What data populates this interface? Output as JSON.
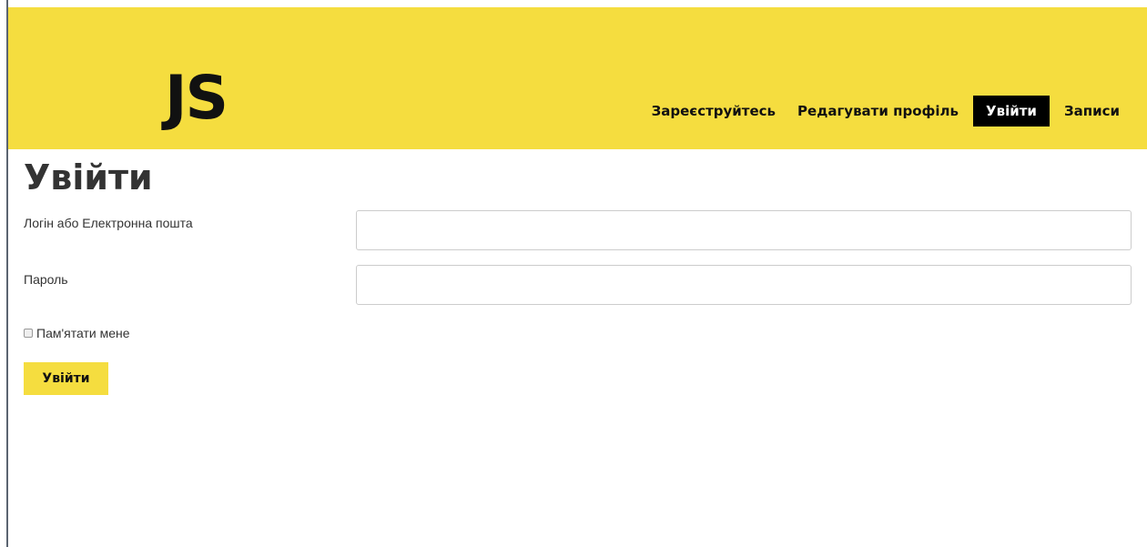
{
  "header": {
    "logo_text": "JS",
    "nav": [
      {
        "label": "Зареєструйтесь",
        "active": false
      },
      {
        "label": "Редагувати профіль",
        "active": false
      },
      {
        "label": "Увійти",
        "active": true
      },
      {
        "label": "Записи",
        "active": false
      }
    ]
  },
  "main": {
    "title": "Увійти",
    "login_label": "Логін або Електронна пошта",
    "login_value": "",
    "password_label": "Пароль",
    "password_value": "",
    "remember_label": "Пам'ятати мене",
    "remember_checked": false,
    "submit_label": "Увійти"
  },
  "colors": {
    "header_bg": "#f5dd3f",
    "active_nav_bg": "#000000",
    "button_bg": "#f5dd3f"
  }
}
